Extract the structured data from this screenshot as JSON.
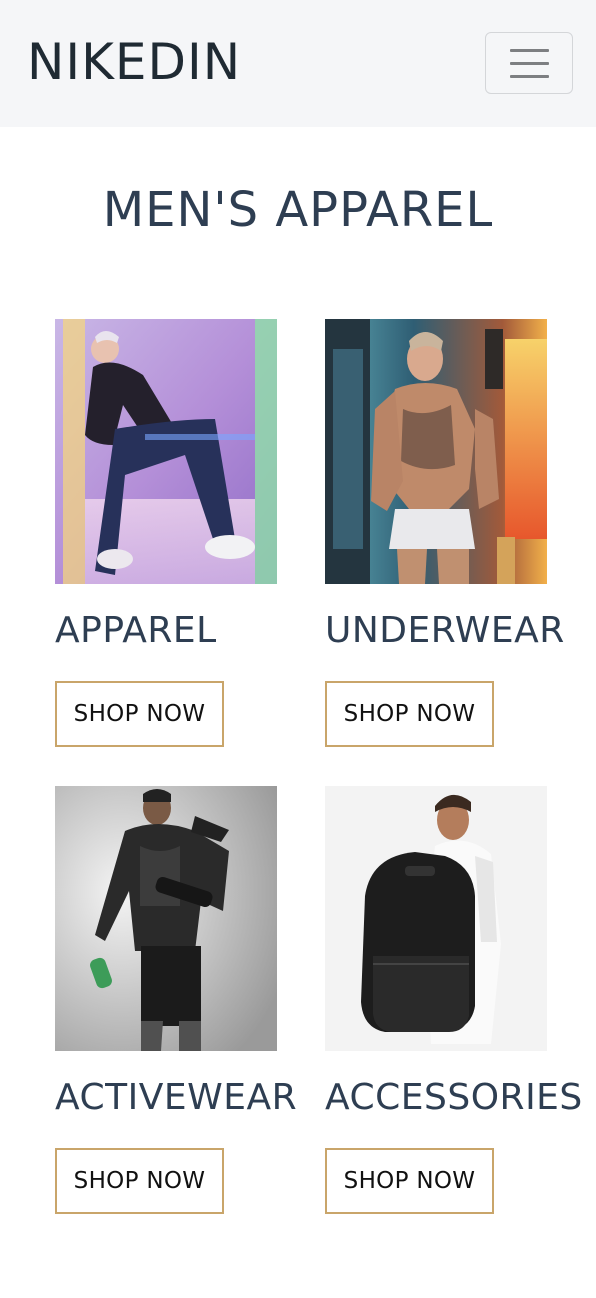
{
  "navbar": {
    "brand": "NIKEDIN",
    "menu_icon": "hamburger-menu-icon"
  },
  "page": {
    "title": "MEN'S APPAREL"
  },
  "categories": [
    {
      "label": "APPAREL",
      "button": "SHOP NOW",
      "image": "apparel-model-photo"
    },
    {
      "label": "UNDERWEAR",
      "button": "SHOP NOW",
      "image": "underwear-model-photo"
    },
    {
      "label": "ACTIVEWEAR",
      "button": "SHOP NOW",
      "image": "activewear-model-photo"
    },
    {
      "label": "ACCESSORIES",
      "button": "SHOP NOW",
      "image": "accessories-backpack-photo"
    }
  ],
  "colors": {
    "navbar_bg": "#f5f6f8",
    "heading": "#2e3e52",
    "button_border": "#c9a56a"
  }
}
